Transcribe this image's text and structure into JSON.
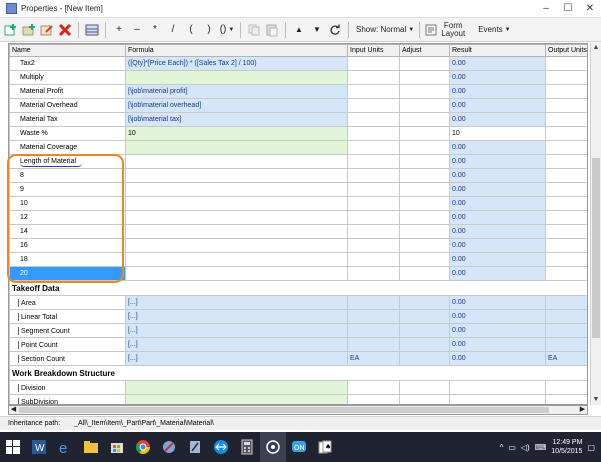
{
  "window": {
    "title": "Properties - [New Item]",
    "controls": [
      "–",
      "☐",
      "✕"
    ]
  },
  "toolbar": {
    "show_label": "Show: Normal",
    "form_layout_line1": "Form",
    "form_layout_line2": "Layout",
    "events_label": "Events",
    "symbols": [
      "+",
      "–",
      "*",
      "/",
      "(",
      ")",
      "()",
      "▲",
      "▼"
    ]
  },
  "columns": [
    "Name",
    "Formula",
    "Input Units",
    "Adjust",
    "Result",
    "Output Units"
  ],
  "rows": [
    {
      "name": "Tax2",
      "formula": "([Qty]*[Price Each]) * ([Sales Tax 2] / 100)",
      "input": "",
      "adjust": "",
      "result": "0.00",
      "output": "",
      "f": "blue",
      "r": "blue"
    },
    {
      "name": "Multiply",
      "formula": "",
      "input": "",
      "adjust": "",
      "result": "0.00",
      "output": "",
      "f": "green",
      "r": "blue"
    },
    {
      "name": "Material Profit",
      "formula": "[\\job\\material profit]",
      "input": "",
      "adjust": "",
      "result": "0.00",
      "output": "",
      "f": "blue",
      "r": "blue"
    },
    {
      "name": "Material Overhead",
      "formula": "[\\job\\material overhead]",
      "input": "",
      "adjust": "",
      "result": "0.00",
      "output": "",
      "f": "blue",
      "r": "blue"
    },
    {
      "name": "Material Tax",
      "formula": "[\\job\\material tax]",
      "input": "",
      "adjust": "",
      "result": "0.00",
      "output": "",
      "f": "blue",
      "r": "blue"
    },
    {
      "name": "Waste %",
      "formula": "10",
      "input": "",
      "adjust": "",
      "result": "10",
      "output": "",
      "f": "green",
      "r": "plain"
    },
    {
      "name": "Material Coverage",
      "formula": "",
      "input": "",
      "adjust": "",
      "result": "0.00",
      "output": "",
      "f": "green",
      "r": "blue"
    },
    {
      "name": "Length of Material",
      "formula": "",
      "input": "",
      "adjust": "",
      "result": "0.00",
      "output": "",
      "f": "plain",
      "r": "blue"
    },
    {
      "name": "8",
      "formula": "",
      "input": "",
      "adjust": "",
      "result": "0.00",
      "output": "",
      "f": "plain",
      "r": "blue"
    },
    {
      "name": "9",
      "formula": "",
      "input": "",
      "adjust": "",
      "result": "0.00",
      "output": "",
      "f": "plain",
      "r": "blue"
    },
    {
      "name": "10",
      "formula": "",
      "input": "",
      "adjust": "",
      "result": "0.00",
      "output": "",
      "f": "plain",
      "r": "blue"
    },
    {
      "name": "12",
      "formula": "",
      "input": "",
      "adjust": "",
      "result": "0.00",
      "output": "",
      "f": "plain",
      "r": "blue"
    },
    {
      "name": "14",
      "formula": "",
      "input": "",
      "adjust": "",
      "result": "0.00",
      "output": "",
      "f": "plain",
      "r": "blue"
    },
    {
      "name": "16",
      "formula": "",
      "input": "",
      "adjust": "",
      "result": "0.00",
      "output": "",
      "f": "plain",
      "r": "blue"
    },
    {
      "name": "18",
      "formula": "",
      "input": "",
      "adjust": "",
      "result": "0.00",
      "output": "",
      "f": "plain",
      "r": "blue"
    },
    {
      "name": "20",
      "formula": "",
      "input": "",
      "adjust": "",
      "result": "0.00",
      "output": "",
      "f": "plain",
      "r": "blue",
      "selected": true
    }
  ],
  "section1": {
    "title": "Takeoff Data",
    "rows": [
      {
        "name": "Area",
        "formula": "[...]",
        "input": "",
        "adjust": "",
        "result": "0.00",
        "output": ""
      },
      {
        "name": "Linear Total",
        "formula": "[...]",
        "input": "",
        "adjust": "",
        "result": "0.00",
        "output": ""
      },
      {
        "name": "Segment Count",
        "formula": "[...]",
        "input": "",
        "adjust": "",
        "result": "0.00",
        "output": ""
      },
      {
        "name": "Point Count",
        "formula": "[...]",
        "input": "",
        "adjust": "",
        "result": "0.00",
        "output": ""
      },
      {
        "name": "Section Count",
        "formula": "[...]",
        "input": "EA",
        "adjust": "",
        "result": "0.00",
        "output": "EA"
      }
    ]
  },
  "section2": {
    "title": "Work Breakdown Structure",
    "rows": [
      {
        "name": "Division"
      },
      {
        "name": "SubDivision"
      }
    ]
  },
  "status": {
    "label": "Inheritance path:",
    "path": "_All\\_Item\\Item\\_Part\\Part\\_Material\\Material\\"
  },
  "clock": {
    "time": "12:49 PM",
    "date": "10/5/2015"
  },
  "colors": {
    "selection": "#3399ff",
    "formula_blue": "#d4e6f7",
    "formula_green": "#e3f5d8",
    "annotation": "#e5882a",
    "taskbar": "#1f2430"
  }
}
